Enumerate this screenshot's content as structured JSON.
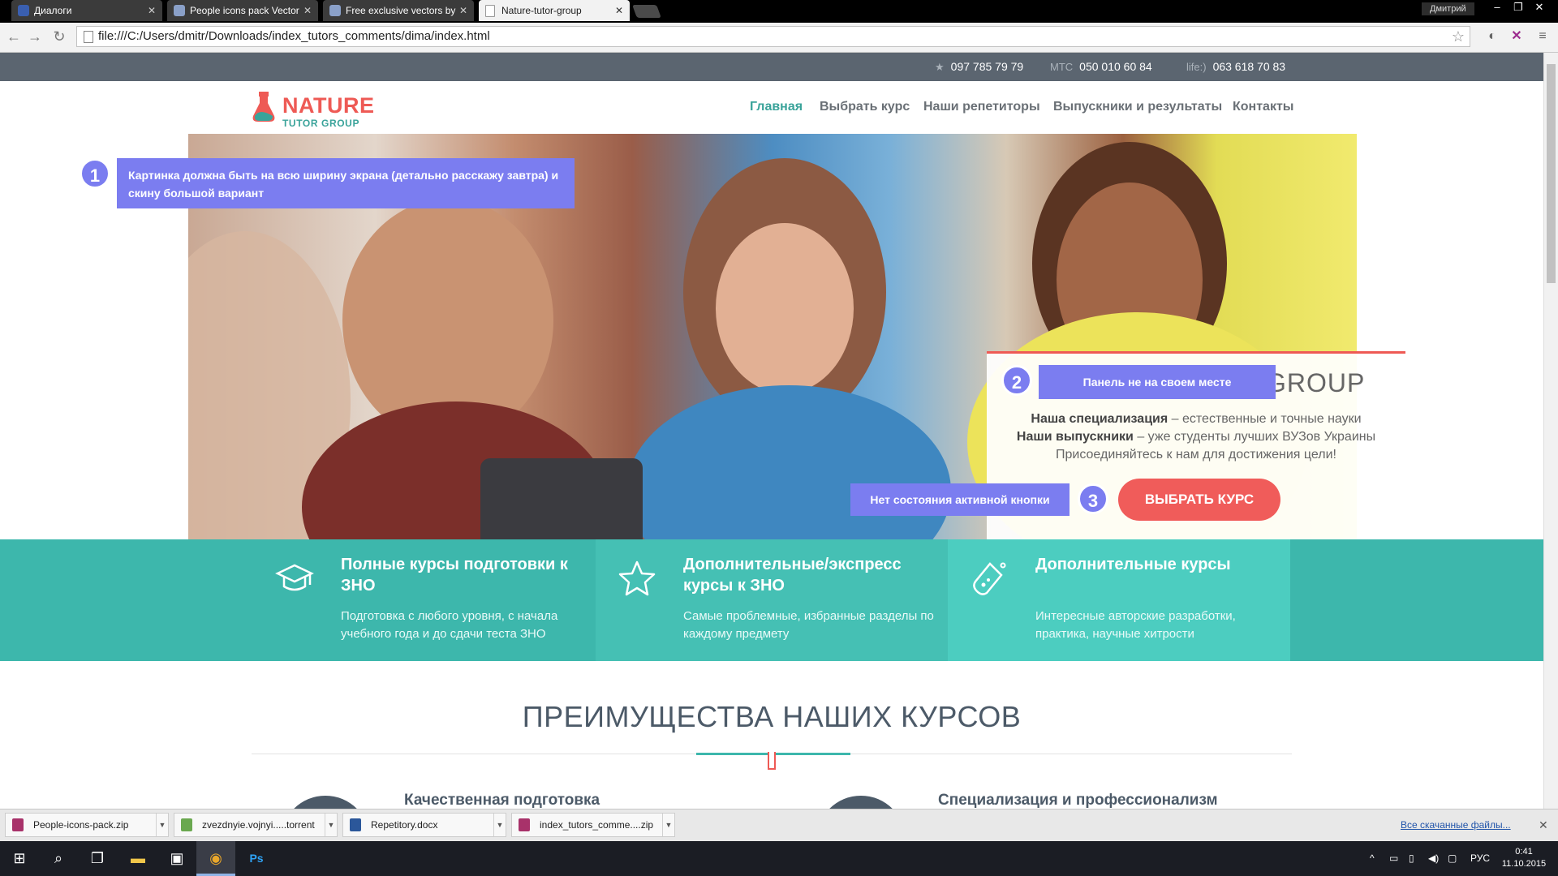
{
  "browser": {
    "tabs": [
      {
        "title": "Диалоги"
      },
      {
        "title": "People icons pack Vector"
      },
      {
        "title": "Free exclusive vectors by"
      },
      {
        "title": "Nature-tutor-group"
      }
    ],
    "user": "Дмитрий",
    "url": "file:///C:/Users/dmitr/Downloads/index_tutors_comments/dima/index.html"
  },
  "page": {
    "phones": [
      {
        "label": "★",
        "number": "097 785 79 79"
      },
      {
        "label": "МТС",
        "number": "050 010 60 84"
      },
      {
        "label": "life:)",
        "number": "063 618 70 83"
      }
    ],
    "logo": {
      "title": "NATURE",
      "subtitle": "TUTOR GROUP"
    },
    "nav": [
      "Главная",
      "Выбрать курс",
      "Наши репетиторы",
      "Выпускники и результаты",
      "Контакты"
    ],
    "notes": {
      "n1": "1",
      "note1": "Картинка должна быть на всю ширину экрана (детально расскажу завтра) и скину большой вариант",
      "n2": "2",
      "note2": "Панель не на своем месте",
      "n3": "3",
      "note3": "Нет состояния активной кнопки"
    },
    "panel": {
      "title_fragment": "GROUP",
      "line1_bold": "Наша специализация",
      "line1_rest": " – естественные и точные науки",
      "line2_bold": "Наши выпускники",
      "line2_rest": " – уже студенты лучших ВУЗов Украины",
      "line3": "Присоединяйтесь к нам для достижения цели!",
      "cta": "ВЫБРАТЬ КУРС"
    },
    "features": [
      {
        "icon": "graduation-cap-icon",
        "title": "Полные курсы подготовки к ЗНО",
        "text": "Подготовка с любого уровня, с начала учебного года и до сдачи теста ЗНО"
      },
      {
        "icon": "star-icon",
        "title": "Дополнительные/экспресс курсы к ЗНО",
        "text": "Самые проблемные, избранные разделы по каждому предмету"
      },
      {
        "icon": "flask-icon",
        "title": "Дополнительные курсы",
        "text": "Интересные авторские разработки, практика, научные хитрости"
      }
    ],
    "section_title": "ПРЕИМУЩЕСТВА НАШИХ КУРСОВ",
    "advantages": [
      "Качественная подготовка",
      "Специализация и профессионализм"
    ],
    "colors": {
      "teal": "#3db7ac",
      "coral": "#f05c5a",
      "note": "#7b7df0",
      "topbar": "#5b6570"
    }
  },
  "downloads": {
    "items": [
      "People-icons-pack.zip",
      "zvezdnyie.vojnyi.....torrent",
      "Repetitory.docx",
      "index_tutors_comme....zip"
    ],
    "show_all": "Все скачанные файлы..."
  },
  "taskbar": {
    "lang": "РУС",
    "time": "0:41",
    "date": "11.10.2015"
  }
}
